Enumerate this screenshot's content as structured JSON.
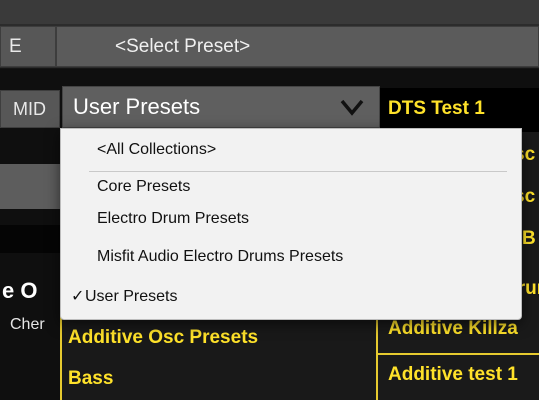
{
  "toolbar": {
    "left_button_label": "E",
    "preset_selector": "<Select Preset>"
  },
  "filter": {
    "left_button_label": "MID",
    "collection_selected": "User Presets"
  },
  "left_column": {
    "partial_title": "e O",
    "partial_subtitle": "Cher"
  },
  "middle_list": {
    "items": [
      "Additive Osc Presets",
      "Bass"
    ]
  },
  "right_list": {
    "header": "DTS Test 1",
    "items": [
      "sc",
      "sc",
      "B",
      "Drun",
      "Additive Killza",
      "Additive test 1"
    ]
  },
  "dropdown": {
    "items": [
      "<All Collections>",
      "Core Presets",
      "Electro Drum Presets",
      "Misfit Audio Electro Drums Presets",
      "User Presets"
    ],
    "checked_index": 4,
    "check_glyph": "✓"
  },
  "colors": {
    "accent_yellow": "#ffe22a",
    "panel_gray": "#5b5b5b",
    "background": "#101010"
  }
}
